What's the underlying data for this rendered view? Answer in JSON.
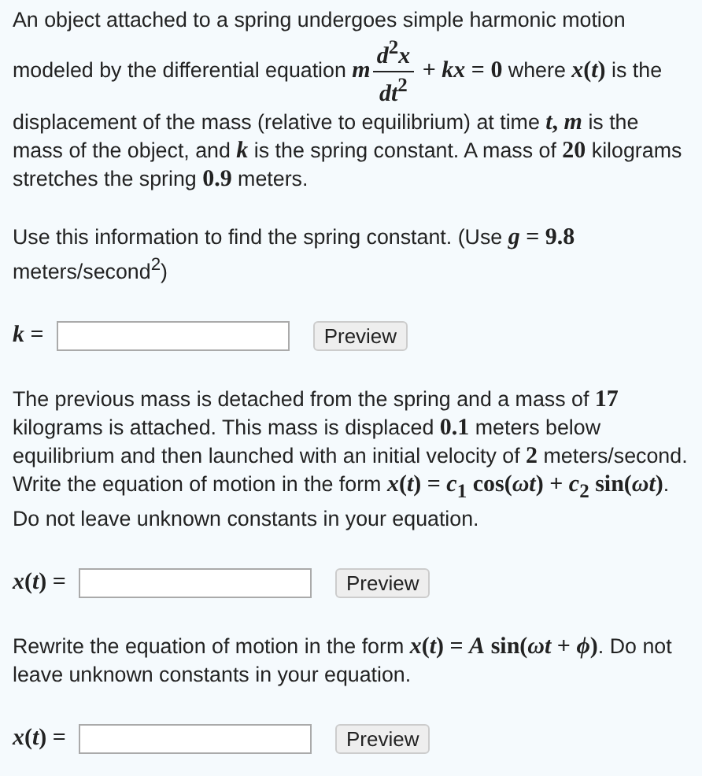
{
  "blocks": [
    {
      "kind": "paragraph",
      "segments": [
        {
          "kind": "text",
          "text": "An object attached to a spring undergoes simple harmonic motion modeled by the differential equation "
        },
        {
          "kind": "math",
          "text": "*m*"
        },
        {
          "kind": "frac",
          "num": "*d*$^{2}$*x*",
          "den": "*dt*$^{2}$"
        },
        {
          "kind": "math",
          "text": " + *kx* = 0"
        },
        {
          "kind": "text",
          "text": " where "
        },
        {
          "kind": "math",
          "text": "*x*(*t*)"
        },
        {
          "kind": "text",
          "text": " is the displacement of the mass (relative to equilibrium) at time "
        },
        {
          "kind": "math",
          "text": "*t*, *m*"
        },
        {
          "kind": "text",
          "text": " is the mass of the object, and "
        },
        {
          "kind": "math",
          "text": "*k*"
        },
        {
          "kind": "text",
          "text": " is the spring constant. A mass of "
        },
        {
          "kind": "math",
          "text": "20"
        },
        {
          "kind": "text",
          "text": " kilograms stretches the spring "
        },
        {
          "kind": "math",
          "text": "0.9"
        },
        {
          "kind": "text",
          "text": " meters."
        }
      ]
    },
    {
      "kind": "paragraph",
      "segments": [
        {
          "kind": "text",
          "text": "Use this information to find the spring constant. (Use "
        },
        {
          "kind": "math",
          "text": "*g* = 9.8"
        },
        {
          "kind": "text",
          "text": " meters/second$^{2}$)"
        }
      ]
    },
    {
      "kind": "answer",
      "label": "*k* =",
      "button": "Preview"
    },
    {
      "kind": "paragraph",
      "segments": [
        {
          "kind": "text",
          "text": "The previous mass is detached from the spring and a mass of "
        },
        {
          "kind": "math",
          "text": "17"
        },
        {
          "kind": "text",
          "text": " kilograms is attached. This mass is displaced "
        },
        {
          "kind": "math",
          "text": "0.1"
        },
        {
          "kind": "text",
          "text": " meters below equilibrium and then launched with an initial velocity of "
        },
        {
          "kind": "math",
          "text": "2"
        },
        {
          "kind": "text",
          "text": " meters/second. Write the equation of motion in the form "
        },
        {
          "kind": "math",
          "text": "*x*(*t*) = *c*$_{1}$ cos(*ωt*) + *c*$_{2}$ sin(*ωt*)"
        },
        {
          "kind": "text",
          "text": ". Do not leave unknown constants in your equation."
        }
      ]
    },
    {
      "kind": "answer",
      "label": "*x*(*t*) =",
      "button": "Preview"
    },
    {
      "kind": "paragraph",
      "segments": [
        {
          "kind": "text",
          "text": "Rewrite the equation of motion in the form "
        },
        {
          "kind": "math",
          "text": "*x*(*t*) = *A* sin(*ωt* + *ϕ*)"
        },
        {
          "kind": "text",
          "text": ". Do not leave unknown constants in your equation."
        }
      ]
    },
    {
      "kind": "answer",
      "label": "*x*(*t*) =",
      "button": "Preview"
    }
  ]
}
